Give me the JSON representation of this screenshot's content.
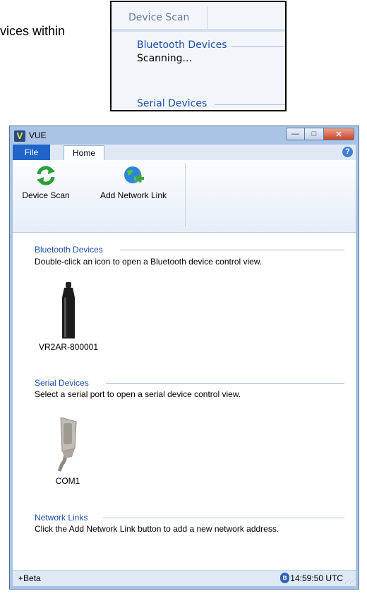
{
  "caption": {
    "text": "vices within"
  },
  "inset": {
    "tab_label": "Device Scan",
    "bluetooth_title": "Bluetooth Devices",
    "scanning_text": "Scanning...",
    "serial_title": "Serial Devices"
  },
  "window": {
    "title": "VUE",
    "app_icon_letter": "V",
    "buttons": {
      "minimize": "—",
      "maximize": "□",
      "close": "✕"
    }
  },
  "tabs": {
    "file": "File",
    "home": "Home"
  },
  "help": {
    "glyph": "?"
  },
  "ribbon": {
    "device_scan_label": "Device Scan",
    "device_scan_icon": "refresh-icon",
    "add_network_label": "Add Network Link",
    "add_network_icon": "globe-add-icon"
  },
  "sections": {
    "bluetooth": {
      "title": "Bluetooth Devices",
      "desc": "Double-click an icon to open a Bluetooth device control view.",
      "device": "VR2AR-800001"
    },
    "serial": {
      "title": "Serial Devices",
      "desc": "Select a serial port to open a serial device control view.",
      "device": "COM1"
    },
    "network": {
      "title": "Network Links",
      "desc": "Click the Add Network Link button to add a new network address."
    }
  },
  "status": {
    "left": "+Beta",
    "bluetooth_glyph": "ʙ",
    "time": "14:59:50 UTC"
  },
  "colors": {
    "accent_blue": "#1f64c8",
    "section_title": "#1f4fa8",
    "frame": "#a9c4e4"
  }
}
